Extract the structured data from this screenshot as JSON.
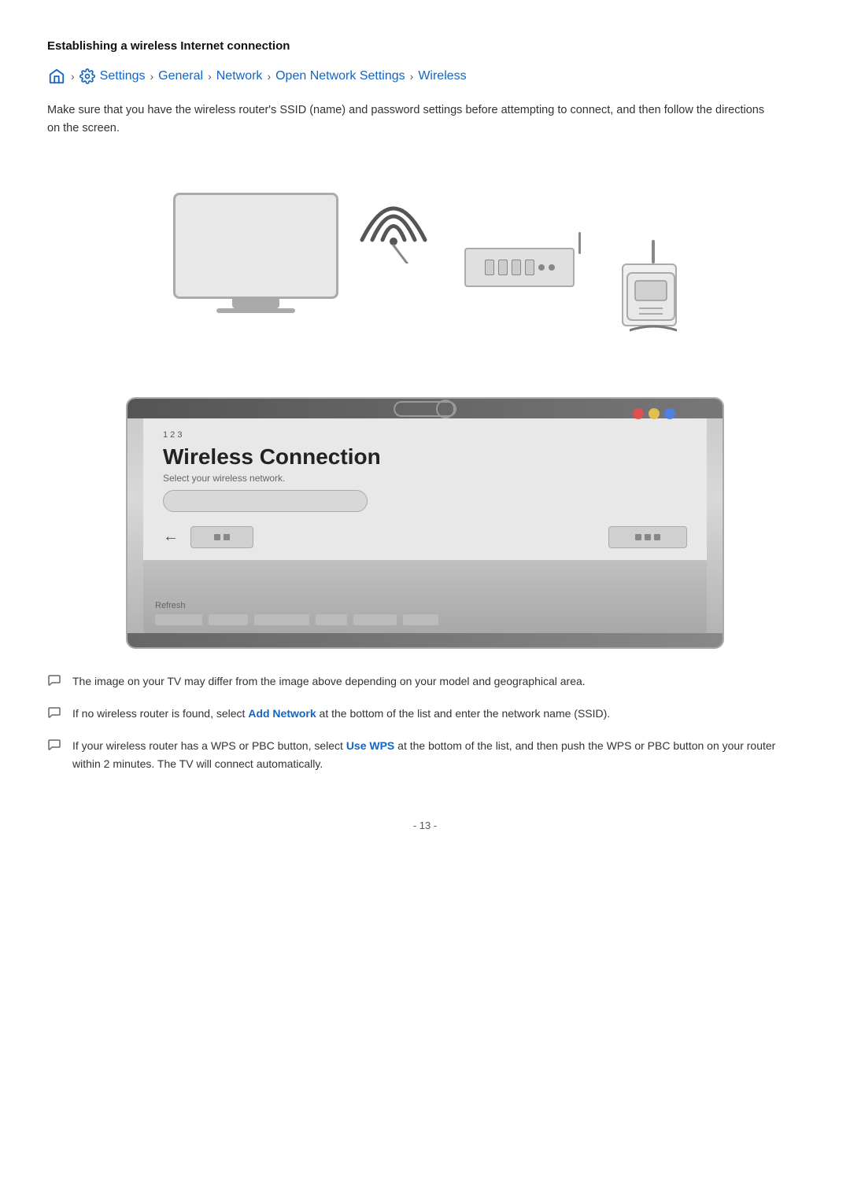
{
  "page": {
    "title": "Establishing a wireless Internet connection",
    "description": "Make sure that you have the wireless router's SSID (name) and password settings before attempting to connect, and then follow the directions on the screen.",
    "breadcrumb": {
      "home_icon": "home",
      "items": [
        {
          "label": "Settings",
          "icon": "gear"
        },
        {
          "label": "General"
        },
        {
          "label": "Network"
        },
        {
          "label": "Open Network Settings"
        },
        {
          "label": "Wireless"
        }
      ],
      "separator": "›"
    },
    "tv_ui": {
      "title": "Wireless Connection",
      "subtitle": "Select your wireless network.",
      "num_row": "1 2 3",
      "refresh_label": "Refresh"
    },
    "notes": [
      {
        "text": "The image on your TV may differ from the image above depending on your model and geographical area."
      },
      {
        "text": "If no wireless router is found, select ",
        "link_text": "Add Network",
        "text_after": " at the bottom of the list and enter the network name (SSID)."
      },
      {
        "text": "If your wireless router has a WPS or PBC button, select ",
        "link_text": "Use WPS",
        "text_after": " at the bottom of the list, and then push the WPS or PBC button on your router within 2 minutes. The TV will connect automatically."
      }
    ],
    "page_number": "- 13 -",
    "colors": {
      "link": "#1565C0",
      "dot_red": "#e05050",
      "dot_yellow": "#e0c050",
      "dot_blue": "#5080e0"
    }
  }
}
